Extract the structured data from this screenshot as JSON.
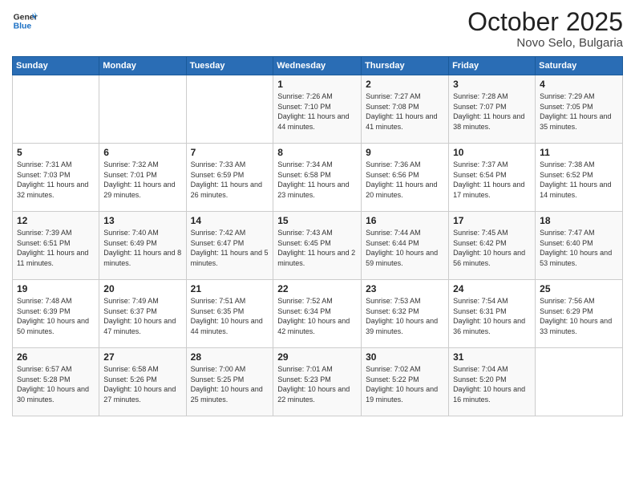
{
  "header": {
    "logo_general": "General",
    "logo_blue": "Blue",
    "month": "October 2025",
    "location": "Novo Selo, Bulgaria"
  },
  "weekdays": [
    "Sunday",
    "Monday",
    "Tuesday",
    "Wednesday",
    "Thursday",
    "Friday",
    "Saturday"
  ],
  "weeks": [
    [
      {
        "day": "",
        "info": ""
      },
      {
        "day": "",
        "info": ""
      },
      {
        "day": "",
        "info": ""
      },
      {
        "day": "1",
        "info": "Sunrise: 7:26 AM\nSunset: 7:10 PM\nDaylight: 11 hours and 44 minutes."
      },
      {
        "day": "2",
        "info": "Sunrise: 7:27 AM\nSunset: 7:08 PM\nDaylight: 11 hours and 41 minutes."
      },
      {
        "day": "3",
        "info": "Sunrise: 7:28 AM\nSunset: 7:07 PM\nDaylight: 11 hours and 38 minutes."
      },
      {
        "day": "4",
        "info": "Sunrise: 7:29 AM\nSunset: 7:05 PM\nDaylight: 11 hours and 35 minutes."
      }
    ],
    [
      {
        "day": "5",
        "info": "Sunrise: 7:31 AM\nSunset: 7:03 PM\nDaylight: 11 hours and 32 minutes."
      },
      {
        "day": "6",
        "info": "Sunrise: 7:32 AM\nSunset: 7:01 PM\nDaylight: 11 hours and 29 minutes."
      },
      {
        "day": "7",
        "info": "Sunrise: 7:33 AM\nSunset: 6:59 PM\nDaylight: 11 hours and 26 minutes."
      },
      {
        "day": "8",
        "info": "Sunrise: 7:34 AM\nSunset: 6:58 PM\nDaylight: 11 hours and 23 minutes."
      },
      {
        "day": "9",
        "info": "Sunrise: 7:36 AM\nSunset: 6:56 PM\nDaylight: 11 hours and 20 minutes."
      },
      {
        "day": "10",
        "info": "Sunrise: 7:37 AM\nSunset: 6:54 PM\nDaylight: 11 hours and 17 minutes."
      },
      {
        "day": "11",
        "info": "Sunrise: 7:38 AM\nSunset: 6:52 PM\nDaylight: 11 hours and 14 minutes."
      }
    ],
    [
      {
        "day": "12",
        "info": "Sunrise: 7:39 AM\nSunset: 6:51 PM\nDaylight: 11 hours and 11 minutes."
      },
      {
        "day": "13",
        "info": "Sunrise: 7:40 AM\nSunset: 6:49 PM\nDaylight: 11 hours and 8 minutes."
      },
      {
        "day": "14",
        "info": "Sunrise: 7:42 AM\nSunset: 6:47 PM\nDaylight: 11 hours and 5 minutes."
      },
      {
        "day": "15",
        "info": "Sunrise: 7:43 AM\nSunset: 6:45 PM\nDaylight: 11 hours and 2 minutes."
      },
      {
        "day": "16",
        "info": "Sunrise: 7:44 AM\nSunset: 6:44 PM\nDaylight: 10 hours and 59 minutes."
      },
      {
        "day": "17",
        "info": "Sunrise: 7:45 AM\nSunset: 6:42 PM\nDaylight: 10 hours and 56 minutes."
      },
      {
        "day": "18",
        "info": "Sunrise: 7:47 AM\nSunset: 6:40 PM\nDaylight: 10 hours and 53 minutes."
      }
    ],
    [
      {
        "day": "19",
        "info": "Sunrise: 7:48 AM\nSunset: 6:39 PM\nDaylight: 10 hours and 50 minutes."
      },
      {
        "day": "20",
        "info": "Sunrise: 7:49 AM\nSunset: 6:37 PM\nDaylight: 10 hours and 47 minutes."
      },
      {
        "day": "21",
        "info": "Sunrise: 7:51 AM\nSunset: 6:35 PM\nDaylight: 10 hours and 44 minutes."
      },
      {
        "day": "22",
        "info": "Sunrise: 7:52 AM\nSunset: 6:34 PM\nDaylight: 10 hours and 42 minutes."
      },
      {
        "day": "23",
        "info": "Sunrise: 7:53 AM\nSunset: 6:32 PM\nDaylight: 10 hours and 39 minutes."
      },
      {
        "day": "24",
        "info": "Sunrise: 7:54 AM\nSunset: 6:31 PM\nDaylight: 10 hours and 36 minutes."
      },
      {
        "day": "25",
        "info": "Sunrise: 7:56 AM\nSunset: 6:29 PM\nDaylight: 10 hours and 33 minutes."
      }
    ],
    [
      {
        "day": "26",
        "info": "Sunrise: 6:57 AM\nSunset: 5:28 PM\nDaylight: 10 hours and 30 minutes."
      },
      {
        "day": "27",
        "info": "Sunrise: 6:58 AM\nSunset: 5:26 PM\nDaylight: 10 hours and 27 minutes."
      },
      {
        "day": "28",
        "info": "Sunrise: 7:00 AM\nSunset: 5:25 PM\nDaylight: 10 hours and 25 minutes."
      },
      {
        "day": "29",
        "info": "Sunrise: 7:01 AM\nSunset: 5:23 PM\nDaylight: 10 hours and 22 minutes."
      },
      {
        "day": "30",
        "info": "Sunrise: 7:02 AM\nSunset: 5:22 PM\nDaylight: 10 hours and 19 minutes."
      },
      {
        "day": "31",
        "info": "Sunrise: 7:04 AM\nSunset: 5:20 PM\nDaylight: 10 hours and 16 minutes."
      },
      {
        "day": "",
        "info": ""
      }
    ]
  ]
}
